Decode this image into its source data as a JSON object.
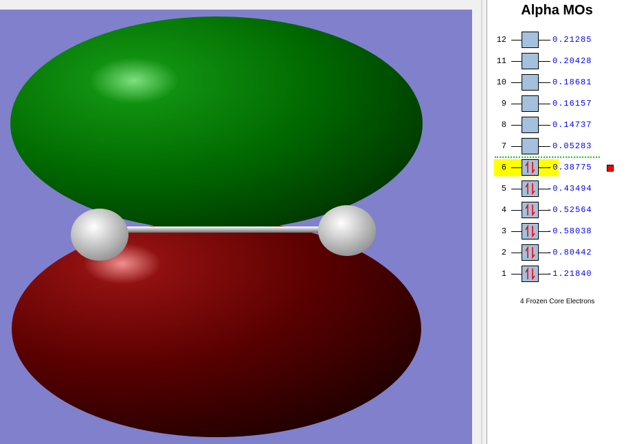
{
  "panel": {
    "title": "Alpha MOs",
    "footer": "4 Frozen Core Electrons",
    "selected": "6",
    "homo": "6"
  },
  "orbitals": [
    {
      "n": "12",
      "energy": "0.21285",
      "occupied": false
    },
    {
      "n": "11",
      "energy": "0.20428",
      "occupied": false
    },
    {
      "n": "10",
      "energy": "0.18681",
      "occupied": false
    },
    {
      "n": "9",
      "energy": "0.16157",
      "occupied": false
    },
    {
      "n": "8",
      "energy": "0.14737",
      "occupied": false
    },
    {
      "n": "7",
      "energy": "0.05283",
      "occupied": false
    },
    {
      "n": "6",
      "energy": "-0.38775",
      "occupied": true
    },
    {
      "n": "5",
      "energy": "-0.43494",
      "occupied": true
    },
    {
      "n": "4",
      "energy": "-0.52564",
      "occupied": true
    },
    {
      "n": "3",
      "energy": "-0.58038",
      "occupied": true
    },
    {
      "n": "2",
      "energy": "-0.80442",
      "occupied": true
    },
    {
      "n": "1",
      "energy": "-1.21840",
      "occupied": true
    }
  ],
  "colors": {
    "positive_lobe": "#008000",
    "negative_lobe": "#800000",
    "background": "#8080cc",
    "highlight": "#ffff00"
  }
}
